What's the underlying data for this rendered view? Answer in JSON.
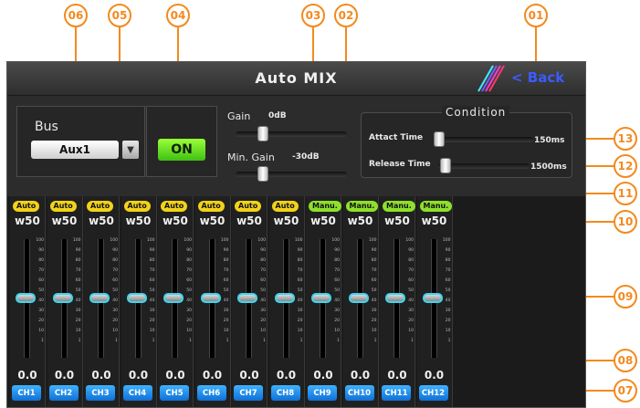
{
  "callouts": [
    "01",
    "02",
    "03",
    "04",
    "05",
    "06",
    "07",
    "08",
    "09",
    "10",
    "11",
    "12",
    "13"
  ],
  "header": {
    "title": "Auto MIX",
    "back_label": "< Back"
  },
  "bus": {
    "label": "Bus",
    "value": "Aux1",
    "on_label": "ON"
  },
  "gain": {
    "label": "Gain",
    "value": "0dB",
    "min_label": "Min.  Gain",
    "min_value": "-30dB"
  },
  "condition": {
    "title": "Condition",
    "attack_label": "Attact Time",
    "attack_value": "150ms",
    "release_label": "Release Time",
    "release_value": "1500ms"
  },
  "scale_marks": [
    "100",
    "90",
    "80",
    "70",
    "60",
    "50",
    "40",
    "30",
    "20",
    "10",
    "1"
  ],
  "colors": {
    "auto_badge": "#f2d21a",
    "manual_badge": "#8ee02a",
    "callout": "#f28a1e"
  },
  "channels": [
    {
      "mode": "Auto",
      "weight": "w50",
      "level": "0.0",
      "name": "CH1"
    },
    {
      "mode": "Auto",
      "weight": "w50",
      "level": "0.0",
      "name": "CH2"
    },
    {
      "mode": "Auto",
      "weight": "w50",
      "level": "0.0",
      "name": "CH3"
    },
    {
      "mode": "Auto",
      "weight": "w50",
      "level": "0.0",
      "name": "CH4"
    },
    {
      "mode": "Auto",
      "weight": "w50",
      "level": "0.0",
      "name": "CH5"
    },
    {
      "mode": "Auto",
      "weight": "w50",
      "level": "0.0",
      "name": "CH6"
    },
    {
      "mode": "Auto",
      "weight": "w50",
      "level": "0.0",
      "name": "CH7"
    },
    {
      "mode": "Auto",
      "weight": "w50",
      "level": "0.0",
      "name": "CH8"
    },
    {
      "mode": "Manu.",
      "weight": "w50",
      "level": "0.0",
      "name": "CH9"
    },
    {
      "mode": "Manu.",
      "weight": "w50",
      "level": "0.0",
      "name": "CH10"
    },
    {
      "mode": "Manu.",
      "weight": "w50",
      "level": "0.0",
      "name": "CH11"
    },
    {
      "mode": "Manu.",
      "weight": "w50",
      "level": "0.0",
      "name": "CH12"
    }
  ]
}
